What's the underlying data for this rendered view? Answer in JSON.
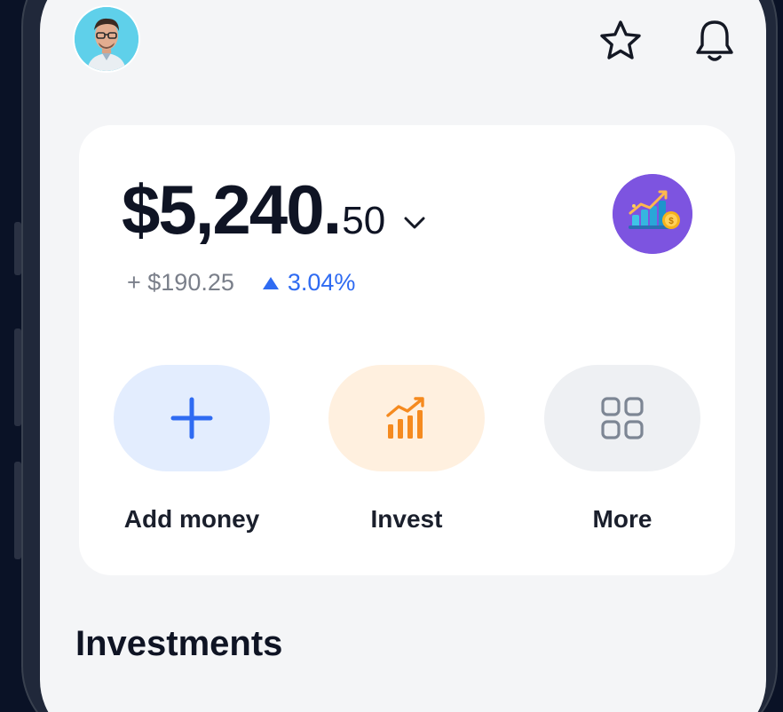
{
  "header": {
    "avatar_name": "avatar",
    "icons": [
      "star-icon",
      "bell-icon"
    ]
  },
  "balance": {
    "whole": "$5,240.",
    "cents": "50",
    "change_amount": "+ $190.25",
    "change_percent": "3.04%",
    "trend": "up",
    "badge_icon": "growth-chart-coin-icon"
  },
  "actions": [
    {
      "label": "Add money",
      "icon": "plus-icon",
      "bg": "#e3edfe",
      "color": "#2f6bf2"
    },
    {
      "label": "Invest",
      "icon": "growth-bars-icon",
      "bg": "#fff0df",
      "color": "#f58a1f"
    },
    {
      "label": "More",
      "icon": "grid-icon",
      "bg": "#eef0f3",
      "color": "#7d8694"
    }
  ],
  "sections": {
    "investments_title": "Investments"
  },
  "colors": {
    "accent_blue": "#2f6bf2",
    "accent_orange": "#f58a1f",
    "badge_purple": "#7d54e0",
    "text_dark": "#0f1424",
    "text_muted": "#7a7f8a",
    "screen_bg": "#f4f5f7",
    "card_bg": "#ffffff"
  }
}
